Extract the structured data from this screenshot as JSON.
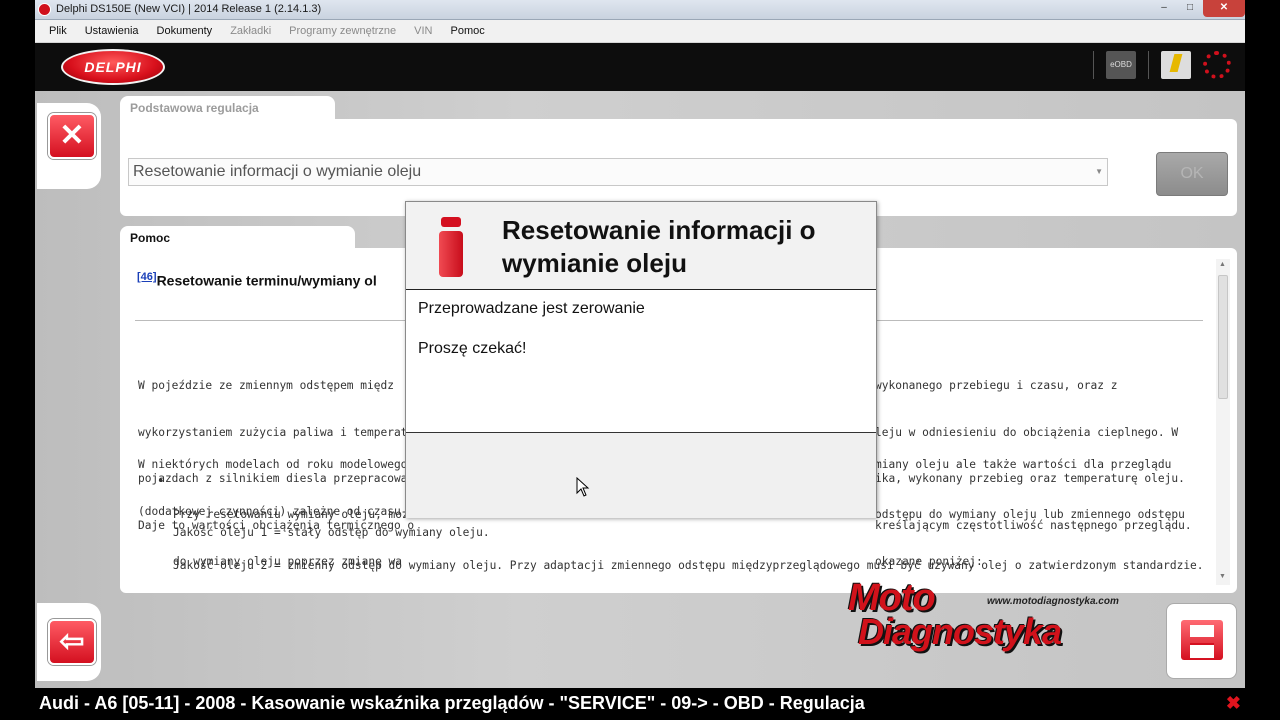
{
  "window": {
    "title": "Delphi DS150E (New VCI) | 2014 Release 1 (2.14.1.3)",
    "controls": {
      "minimize": "–",
      "maximize": "□",
      "close": "✕"
    }
  },
  "menu": {
    "items": [
      {
        "label": "Plik",
        "enabled": true
      },
      {
        "label": "Ustawienia",
        "enabled": true
      },
      {
        "label": "Dokumenty",
        "enabled": true
      },
      {
        "label": "Zakładki",
        "enabled": false
      },
      {
        "label": "Programy zewnętrzne",
        "enabled": false
      },
      {
        "label": "VIN",
        "enabled": false
      },
      {
        "label": "Pomoc",
        "enabled": true
      }
    ]
  },
  "header": {
    "logo_text": "DELPHI",
    "eobd_label": "eOBD"
  },
  "top_panel": {
    "tab_label": "Podstawowa regulacja",
    "combo_value": "Resetowanie informacji o wymianie oleju",
    "ok_label": "OK"
  },
  "help_panel": {
    "tab_label": "Pomoc",
    "ref": "[46]",
    "heading": "Resetowanie terminu/wymiany ol",
    "para1": [
      "W pojeździe ze zmiennym odstępem międz",
      "wykorzystaniem zużycia paliwa i temperatu",
      "pojazdach z silnikiem diesla przepracowani",
      "Daje to wartości obciążenia termicznego o"
    ],
    "para1_right": [
      "wykonanego przebiegu i czasu, oraz z",
      "leju w odniesieniu do obciążenia cieplnego. W",
      "ika, wykonany przebieg oraz temperaturę oleju.",
      "kreślającym częstotliwość następnego przeglądu."
    ],
    "para2": [
      "W niektórych modelach od roku modelowego",
      "(dodatkowej czynności) zależne od czasu-"
    ],
    "para2_right": [
      "miany oleju ale także wartości dla przeglądu"
    ],
    "bullet1": [
      "Przy resetowaniu wymiany oleju, moz",
      "do wymiany oleju poprzez zmianę wa"
    ],
    "bullet1_right": [
      "odstępu do wymiany oleju lub zmiennego odstępu",
      "okazane poniżej:"
    ],
    "quality1": "Jakość oleju 1 = stały odstęp do wymiany oleju.",
    "quality2": "Jakość oleju 2 = zmienny odstęp do wymiany oleju. Przy adaptacji zmiennego odstępu międzyprzeglądowego musi być używany olej o zatwierdzonym standardzie."
  },
  "watermark": {
    "url": "www.motodiagnostyka.com",
    "line1": "Moto",
    "line2": "Diagnostyka"
  },
  "modal": {
    "title": "Resetowanie informacji o wymianie oleju",
    "line1": "Przeprowadzane jest zerowanie",
    "line2": "Proszę czekać!"
  },
  "status": {
    "text": "Audi - A6 [05-11] - 2008 - Kasowanie wskaźnika przeglądów - \"SERVICE\" - 09-> - OBD - Regulacja",
    "close": "✖"
  },
  "colors": {
    "accent": "#d41020",
    "header_bg": "#0d0d0d"
  }
}
